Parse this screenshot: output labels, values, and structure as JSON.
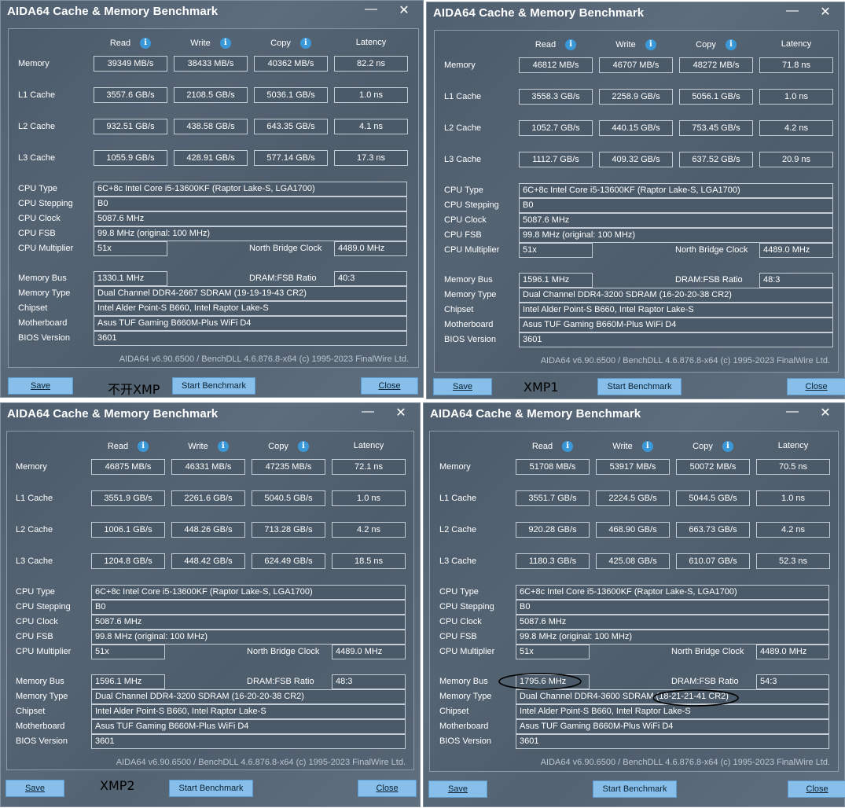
{
  "app_title": "AIDA64 Cache & Memory Benchmark",
  "titlebar": {
    "minimize_glyph": "—",
    "close_glyph": "✕"
  },
  "columns": {
    "read": "Read",
    "write": "Write",
    "copy": "Copy",
    "latency": "Latency",
    "info_glyph": "i"
  },
  "row_labels": {
    "memory": "Memory",
    "l1": "L1 Cache",
    "l2": "L2 Cache",
    "l3": "L3 Cache",
    "cpu_type": "CPU Type",
    "cpu_stepping": "CPU Stepping",
    "cpu_clock": "CPU Clock",
    "cpu_fsb": "CPU FSB",
    "cpu_multiplier": "CPU Multiplier",
    "nb_clock": "North Bridge Clock",
    "memory_bus": "Memory Bus",
    "dram_fsb": "DRAM:FSB Ratio",
    "memory_type": "Memory Type",
    "chipset": "Chipset",
    "motherboard": "Motherboard",
    "bios": "BIOS Version"
  },
  "buttons": {
    "save": "Save",
    "start": "Start Benchmark",
    "close": "Close"
  },
  "footer": "AIDA64 v6.90.6500 / BenchDLL 4.6.876.8-x64  (c) 1995-2023 FinalWire Ltd.",
  "shared": {
    "cpu_type": "6C+8c Intel Core i5-13600KF  (Raptor Lake-S, LGA1700)",
    "cpu_stepping": "B0",
    "cpu_clock": "5087.6 MHz",
    "cpu_fsb": "99.8 MHz  (original: 100 MHz)",
    "cpu_multiplier": "51x",
    "nb_clock": "4489.0 MHz",
    "chipset": "Intel Alder Point-S B660, Intel Raptor Lake-S",
    "motherboard": "Asus TUF Gaming B660M-Plus WiFi D4",
    "bios": "3601"
  },
  "windows": [
    {
      "annotation": "不开XMP",
      "memory": [
        "39349 MB/s",
        "38433 MB/s",
        "40362 MB/s",
        "82.2 ns"
      ],
      "l1": [
        "3557.6 GB/s",
        "2108.5 GB/s",
        "5036.1 GB/s",
        "1.0 ns"
      ],
      "l2": [
        "932.51 GB/s",
        "438.58 GB/s",
        "643.35 GB/s",
        "4.1 ns"
      ],
      "l3": [
        "1055.9 GB/s",
        "428.91 GB/s",
        "577.14 GB/s",
        "17.3 ns"
      ],
      "memory_bus": "1330.1 MHz",
      "dram_fsb": "40:3",
      "memory_type": "Dual Channel DDR4-2667 SDRAM  (19-19-19-43 CR2)"
    },
    {
      "annotation": "XMP1",
      "memory": [
        "46812 MB/s",
        "46707 MB/s",
        "48272 MB/s",
        "71.8 ns"
      ],
      "l1": [
        "3558.3 GB/s",
        "2258.9 GB/s",
        "5056.1 GB/s",
        "1.0 ns"
      ],
      "l2": [
        "1052.7 GB/s",
        "440.15 GB/s",
        "753.45 GB/s",
        "4.2 ns"
      ],
      "l3": [
        "1112.7 GB/s",
        "409.32 GB/s",
        "637.52 GB/s",
        "20.9 ns"
      ],
      "memory_bus": "1596.1 MHz",
      "dram_fsb": "48:3",
      "memory_type": "Dual Channel DDR4-3200 SDRAM  (16-20-20-38 CR2)"
    },
    {
      "annotation": "XMP2",
      "memory": [
        "46875 MB/s",
        "46331 MB/s",
        "47235 MB/s",
        "72.1 ns"
      ],
      "l1": [
        "3551.9 GB/s",
        "2261.6 GB/s",
        "5040.5 GB/s",
        "1.0 ns"
      ],
      "l2": [
        "1006.1 GB/s",
        "448.26 GB/s",
        "713.28 GB/s",
        "4.2 ns"
      ],
      "l3": [
        "1204.8 GB/s",
        "448.42 GB/s",
        "624.49 GB/s",
        "18.5 ns"
      ],
      "memory_bus": "1596.1 MHz",
      "dram_fsb": "48:3",
      "memory_type": "Dual Channel DDR4-3200 SDRAM  (16-20-20-38 CR2)"
    },
    {
      "annotation": "",
      "memory": [
        "51708 MB/s",
        "53917 MB/s",
        "50072 MB/s",
        "70.5 ns"
      ],
      "l1": [
        "3551.7 GB/s",
        "2224.5 GB/s",
        "5044.5 GB/s",
        "1.0 ns"
      ],
      "l2": [
        "920.28 GB/s",
        "468.90 GB/s",
        "663.73 GB/s",
        "4.2 ns"
      ],
      "l3": [
        "1180.3 GB/s",
        "425.08 GB/s",
        "610.07 GB/s",
        "52.3 ns"
      ],
      "memory_bus": "1795.6 MHz",
      "dram_fsb": "54:3",
      "memory_type": "Dual Channel DDR4-3600 SDRAM  (18-21-21-41 CR2)"
    }
  ]
}
